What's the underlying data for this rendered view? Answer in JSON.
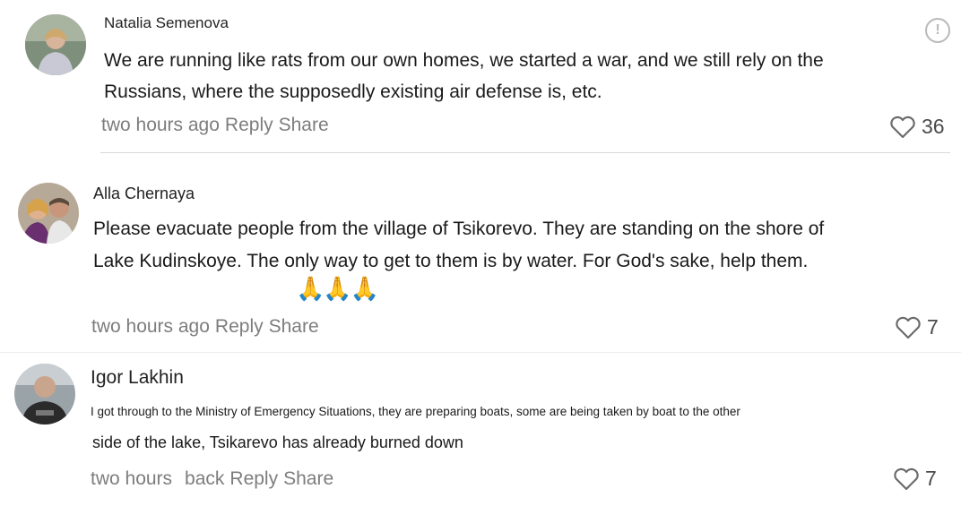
{
  "comments": [
    {
      "author": "Natalia Semenova",
      "text_lines": [
        "We are running like rats from our own homes, we started a war, and we still rely on the",
        "Russians, where the supposedly existing air defense is, etc."
      ],
      "time": "two hours ago",
      "reply": "Reply",
      "share": "Share",
      "likes": "36"
    },
    {
      "author": "Alla Chernaya",
      "text_lines": [
        "Please evacuate people from the village of Tsikorevo. They are standing on the shore of",
        "Lake Kudinskoye. The only way to get to them is by water. For God's sake, help them."
      ],
      "emoji": "🙏🙏🙏",
      "time": "two hours ago",
      "reply": "Reply",
      "share": "Share",
      "likes": "7"
    },
    {
      "author": "Igor Lakhin",
      "text_small": "I got through to the Ministry of Emergency Situations, they are preparing boats, some are being taken by boat to the other",
      "text_line2": "side of the lake, Tsikarevo has already burned down",
      "time_part1": "two hours",
      "time_part2": "back",
      "reply": "Reply",
      "share": "Share",
      "likes": "7"
    }
  ],
  "colors": {
    "meta_text": "#7d7d7d",
    "divider": "#d9d9d9",
    "heart": "#6b6b6b"
  },
  "icons": {
    "like": "heart-outline-icon",
    "report": "exclamation-circle-icon"
  }
}
